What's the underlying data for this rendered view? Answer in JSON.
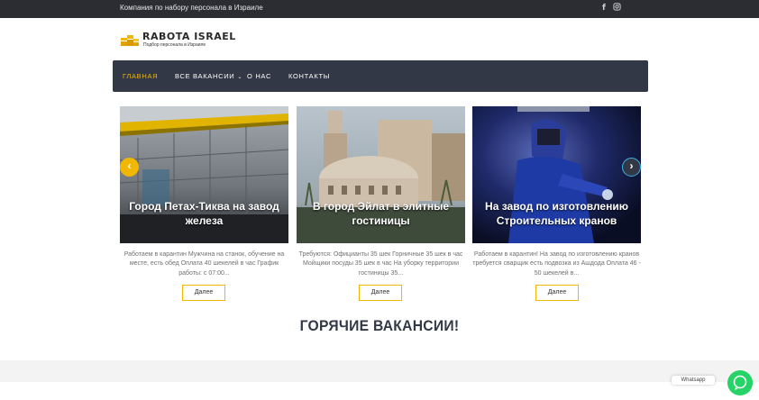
{
  "topbar": {
    "tagline": "Компания по набору персонала в Израиле",
    "facebook_icon": "facebook-icon",
    "instagram_icon": "instagram-icon"
  },
  "logo": {
    "name": "RABOTA ISRAEL",
    "subtitle": "Подбор персонала в Израиле"
  },
  "nav": {
    "items": [
      {
        "label": "ГЛАВНАЯ",
        "active": true
      },
      {
        "label": "ВСЕ ВАКАНСИИ",
        "dropdown": true
      },
      {
        "label": "О НАС"
      },
      {
        "label": "КОНТАКТЫ"
      }
    ]
  },
  "slider": {
    "cards": [
      {
        "title": "Город Петах-Тиква на завод железа",
        "excerpt": "Работаем в карантин Мужчина на станок, обучение на месте, есть обед Оплата 40 шекелей в час График работы: с 07:00...",
        "button": "Далее"
      },
      {
        "title": "В город Эйлат в элитные гостиницы",
        "excerpt": "Требуются: Официанты 35 шек Горничные 35 шек в час Мойщики посуды 35 шек в час На уборку территории гостиницы 35...",
        "button": "Далее"
      },
      {
        "title": "На завод по изготовлению Строительных кранов",
        "excerpt": "Работаем в карантин! На завод по изготовлению кранов требуется сварщик есть подвозка из Ашдода Оплата 46 - 50 шекелей в...",
        "button": "Далее"
      }
    ],
    "prev_glyph": "‹",
    "next_glyph": "›"
  },
  "section": {
    "title": "ГОРЯЧИЕ ВАКАНСИИ!"
  },
  "chat": {
    "label": "Whatsapp"
  },
  "colors": {
    "accent": "#f2b705",
    "nav_bg": "#323846",
    "topbar_bg": "#2b2d33",
    "whatsapp": "#25d366"
  }
}
